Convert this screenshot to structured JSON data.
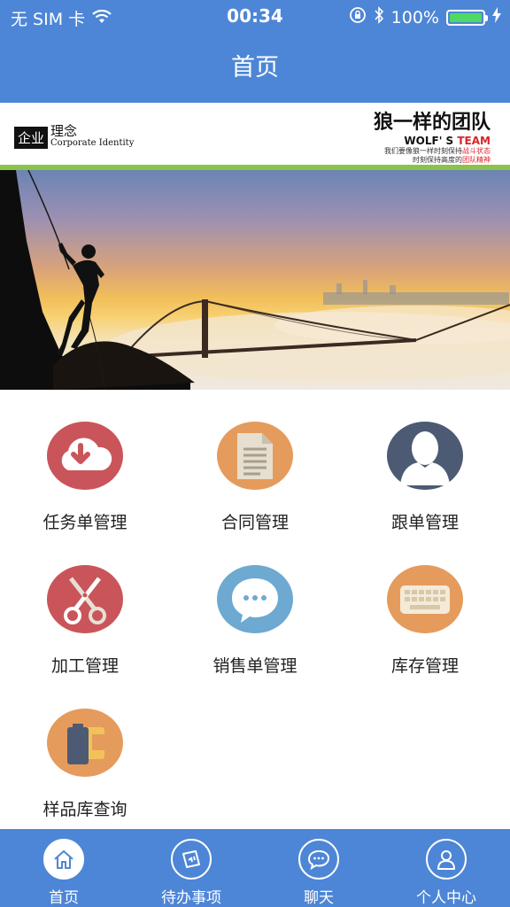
{
  "status_bar": {
    "carrier": "无 SIM 卡",
    "time": "00:34",
    "battery_percent": "100%",
    "battery_level": 1.0,
    "icons": [
      "wifi-icon",
      "orientation-lock-icon",
      "bluetooth-icon",
      "battery-icon",
      "charging-icon"
    ]
  },
  "nav": {
    "title": "首页"
  },
  "banner": {
    "ci_black": "企业",
    "ci_cn": "理念",
    "ci_en": "Corporate Identity",
    "team_cn": "狼一样的团队",
    "team_en_a": "WOLF' S",
    "team_en_b": "TEAM",
    "team_line1_a": "我们要像狼一样时刻保持",
    "team_line1_b": "战斗状态",
    "team_line2_a": "时刻保持高度的",
    "team_line2_b": "团队精神"
  },
  "menu": [
    {
      "label": "任务单管理",
      "icon": "cloud-download-icon",
      "color": "#c9555a"
    },
    {
      "label": "合同管理",
      "icon": "document-icon",
      "color": "#e59b5c"
    },
    {
      "label": "跟单管理",
      "icon": "user-silhouette-icon",
      "color": "#4d5a73"
    },
    {
      "label": "加工管理",
      "icon": "scissors-icon",
      "color": "#c9555a"
    },
    {
      "label": "销售单管理",
      "icon": "chat-bubble-icon",
      "color": "#6da9d1"
    },
    {
      "label": "库存管理",
      "icon": "keyboard-icon",
      "color": "#e59b5c"
    },
    {
      "label": "样品库查询",
      "icon": "battery-folder-icon",
      "color": "#e59b5c"
    }
  ],
  "tabs": [
    {
      "label": "首页",
      "icon": "home-icon",
      "active": true
    },
    {
      "label": "待办事项",
      "icon": "todo-icon",
      "active": false
    },
    {
      "label": "聊天",
      "icon": "chat-icon",
      "active": false
    },
    {
      "label": "个人中心",
      "icon": "person-icon",
      "active": false
    }
  ],
  "colors": {
    "primary": "#4d86d6",
    "accent_green": "#8bc34a",
    "battery_green": "#4cd964",
    "team_red": "#d9242b"
  }
}
